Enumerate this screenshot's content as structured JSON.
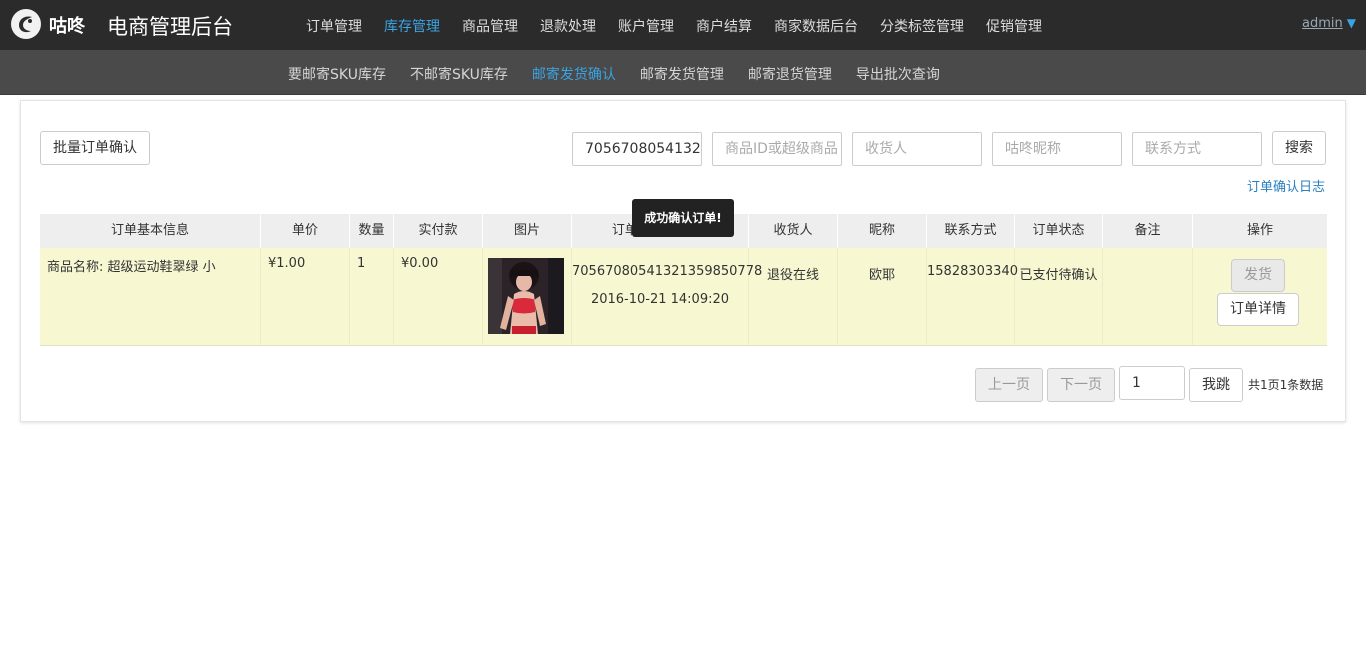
{
  "header": {
    "brand": "咕咚",
    "app_title": "电商管理后台",
    "nav": [
      "订单管理",
      "库存管理",
      "商品管理",
      "退款处理",
      "账户管理",
      "商户结算",
      "商家数据后台",
      "分类标签管理",
      "促销管理"
    ],
    "active_nav": "库存管理",
    "user": "admin",
    "user_caret": "▼"
  },
  "subnav": {
    "items": [
      "要邮寄SKU库存",
      "不邮寄SKU库存",
      "邮寄发货确认",
      "邮寄发货管理",
      "邮寄退货管理",
      "导出批次查询"
    ],
    "active": "邮寄发货确认"
  },
  "toolbar": {
    "batch_confirm": "批量订单确认",
    "order_id_value": "7056708054132",
    "product_id_placeholder": "商品ID或超级商品",
    "receiver_placeholder": "收货人",
    "nickname_placeholder": "咕咚昵称",
    "contact_placeholder": "联系方式",
    "search": "搜索",
    "log_link": "订单确认日志"
  },
  "table": {
    "headers": [
      "订单基本信息",
      "单价",
      "数量",
      "实付款",
      "图片",
      "订单ID/创建时间",
      "收货人",
      "昵称",
      "联系方式",
      "订单状态",
      "备注",
      "操作"
    ],
    "rows": [
      {
        "product": "商品名称: 超级运动鞋翠绿 小",
        "price": "¥1.00",
        "qty": "1",
        "paid": "¥0.00",
        "order_id": "70567080541321359850778",
        "created": "2016-10-21 14:09:20",
        "receiver": "退役在线",
        "nickname": "欧耶",
        "contact": "15828303340",
        "status": "已支付待确认",
        "remark": "",
        "ship": "发货",
        "detail": "订单详情"
      }
    ]
  },
  "tooltip": "成功确认订单!",
  "pagination": {
    "prev": "上一页",
    "next": "下一页",
    "page_value": "1",
    "jump": "我跳",
    "info": "共1页1条数据"
  },
  "colors": {
    "topbar": "#2b2b2b",
    "subbar": "#4a4a4a",
    "accent": "#3aa3e3",
    "row_highlight": "#f7f8d2"
  }
}
